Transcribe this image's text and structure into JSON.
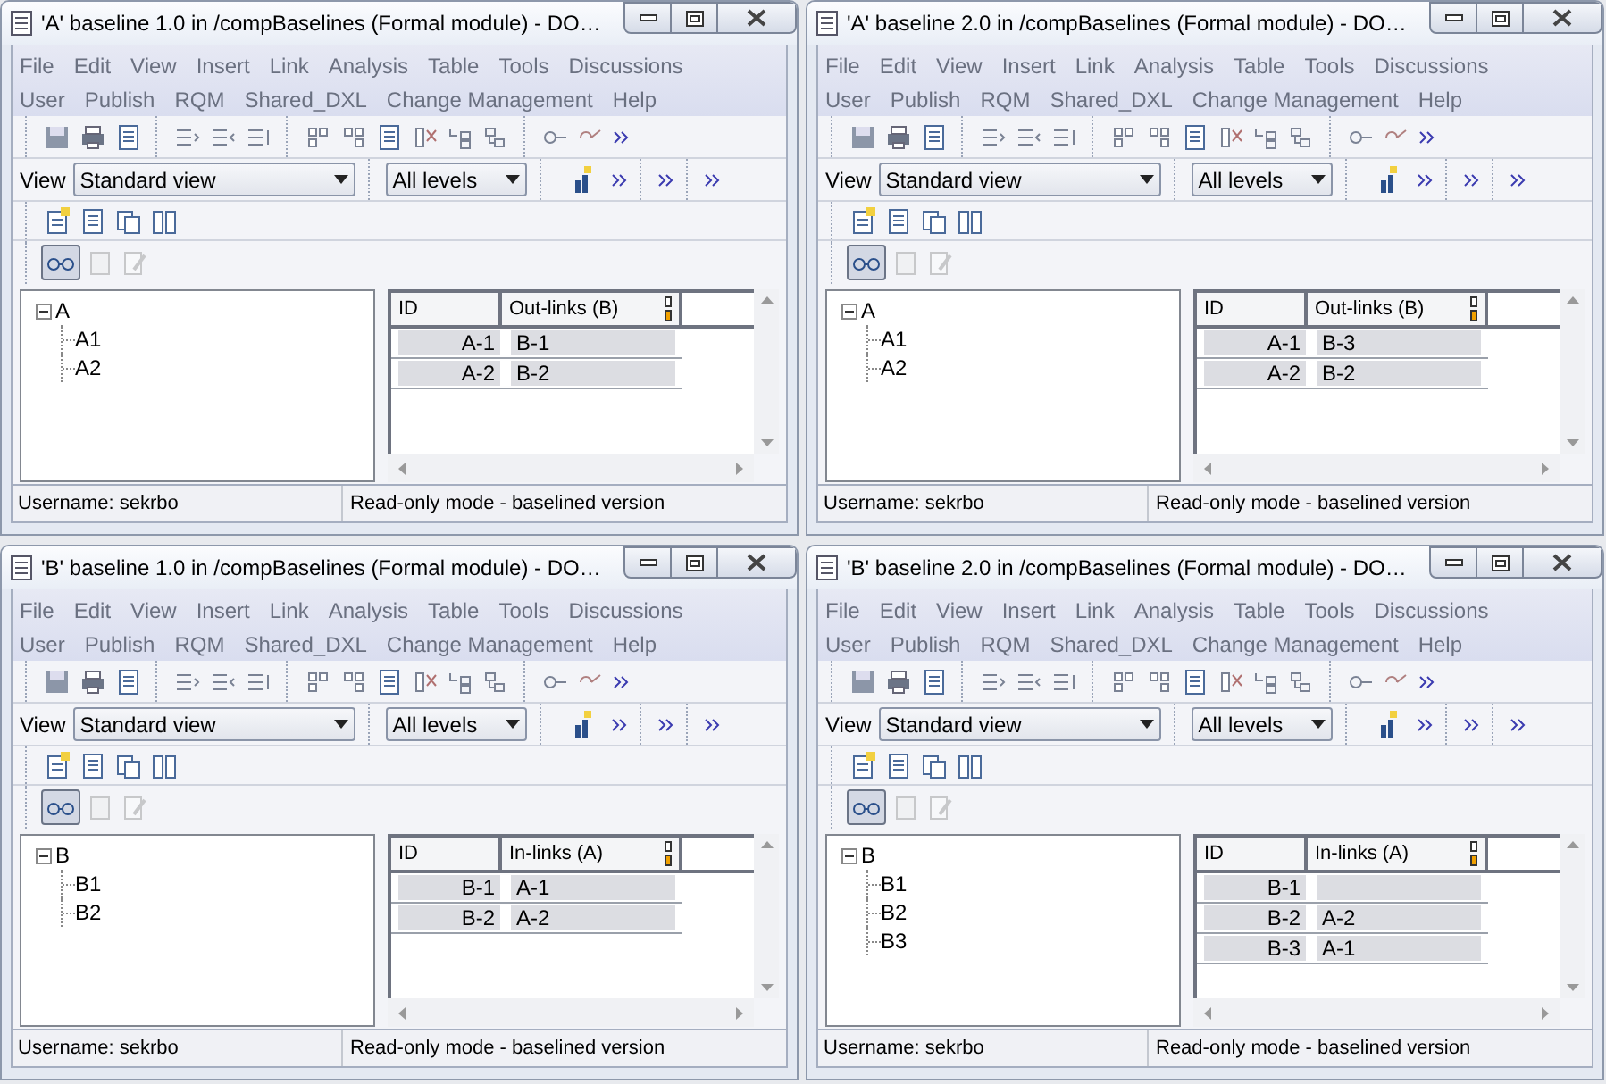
{
  "windows": [
    {
      "title": "'A' baseline 1.0 in /compBaselines (Formal module) - DO…",
      "menus": [
        [
          "File",
          "Edit",
          "View",
          "Insert",
          "Link",
          "Analysis",
          "Table",
          "Tools",
          "Discussions"
        ],
        [
          "User",
          "Publish",
          "RQM",
          "Shared_DXL",
          "Change Management",
          "Help"
        ]
      ],
      "view_label": "View",
      "view": "Standard view",
      "levels": "All levels",
      "tree": {
        "label": "A",
        "expanded": true,
        "children": [
          {
            "label": "A1"
          },
          {
            "label": "A2"
          }
        ]
      },
      "columns": [
        "ID",
        "Out-links (B)"
      ],
      "rows": [
        [
          "A-1",
          "B-1"
        ],
        [
          "A-2",
          "B-2"
        ]
      ],
      "status": [
        "Username: sekrbo",
        "Read-only mode - baselined version"
      ]
    },
    {
      "title": "'A' baseline 2.0 in /compBaselines (Formal module) - DO…",
      "menus": [
        [
          "File",
          "Edit",
          "View",
          "Insert",
          "Link",
          "Analysis",
          "Table",
          "Tools",
          "Discussions"
        ],
        [
          "User",
          "Publish",
          "RQM",
          "Shared_DXL",
          "Change Management",
          "Help"
        ]
      ],
      "view_label": "View",
      "view": "Standard view",
      "levels": "All levels",
      "tree": {
        "label": "A",
        "expanded": true,
        "children": [
          {
            "label": "A1"
          },
          {
            "label": "A2"
          }
        ]
      },
      "columns": [
        "ID",
        "Out-links (B)"
      ],
      "rows": [
        [
          "A-1",
          "B-3"
        ],
        [
          "A-2",
          "B-2"
        ]
      ],
      "status": [
        "Username: sekrbo",
        "Read-only mode - baselined version"
      ]
    },
    {
      "title": "'B' baseline 1.0 in /compBaselines (Formal module) - DO…",
      "menus": [
        [
          "File",
          "Edit",
          "View",
          "Insert",
          "Link",
          "Analysis",
          "Table",
          "Tools",
          "Discussions"
        ],
        [
          "User",
          "Publish",
          "RQM",
          "Shared_DXL",
          "Change Management",
          "Help"
        ]
      ],
      "view_label": "View",
      "view": "Standard view",
      "levels": "All levels",
      "tree": {
        "label": "B",
        "expanded": true,
        "children": [
          {
            "label": "B1"
          },
          {
            "label": "B2"
          }
        ]
      },
      "columns": [
        "ID",
        "In-links (A)"
      ],
      "rows": [
        [
          "B-1",
          "A-1"
        ],
        [
          "B-2",
          "A-2"
        ]
      ],
      "status": [
        "Username: sekrbo",
        "Read-only mode - baselined version"
      ]
    },
    {
      "title": "'B' baseline 2.0 in /compBaselines (Formal module) - DO…",
      "menus": [
        [
          "File",
          "Edit",
          "View",
          "Insert",
          "Link",
          "Analysis",
          "Table",
          "Tools",
          "Discussions"
        ],
        [
          "User",
          "Publish",
          "RQM",
          "Shared_DXL",
          "Change Management",
          "Help"
        ]
      ],
      "view_label": "View",
      "view": "Standard view",
      "levels": "All levels",
      "tree": {
        "label": "B",
        "expanded": true,
        "children": [
          {
            "label": "B1"
          },
          {
            "label": "B2"
          },
          {
            "label": "B3"
          }
        ]
      },
      "columns": [
        "ID",
        "In-links (A)"
      ],
      "rows": [
        [
          "B-1",
          ""
        ],
        [
          "B-2",
          "A-2"
        ],
        [
          "B-3",
          "A-1"
        ]
      ],
      "status": [
        "Username: sekrbo",
        "Read-only mode - baselined version"
      ]
    }
  ]
}
